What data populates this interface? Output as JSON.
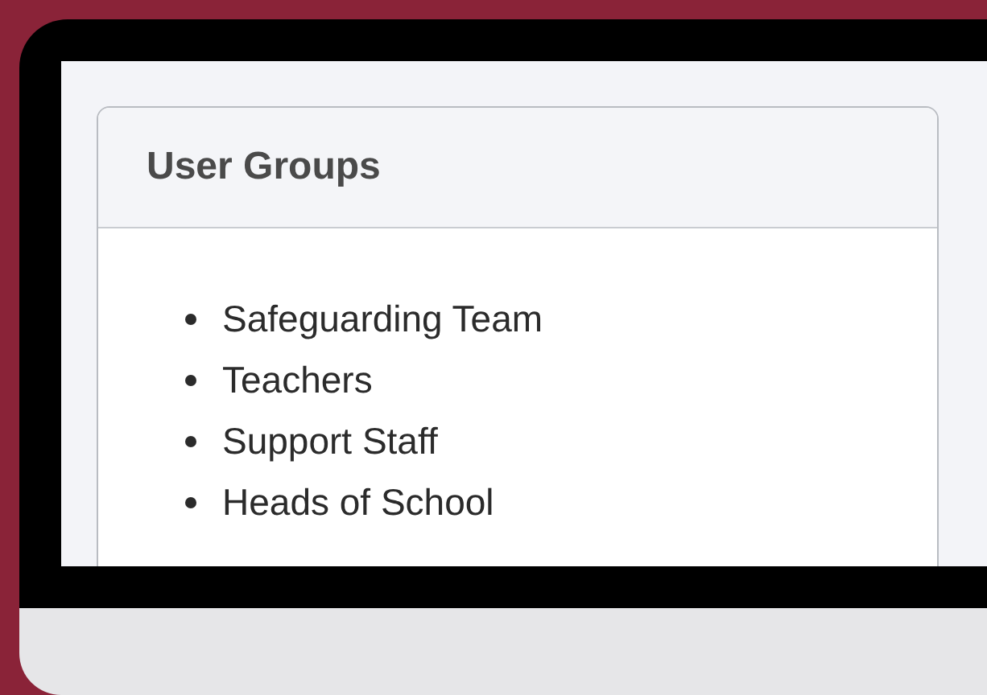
{
  "panel": {
    "title": "User Groups",
    "items": [
      "Safeguarding Team",
      "Teachers",
      "Support Staff",
      "Heads of School"
    ]
  }
}
